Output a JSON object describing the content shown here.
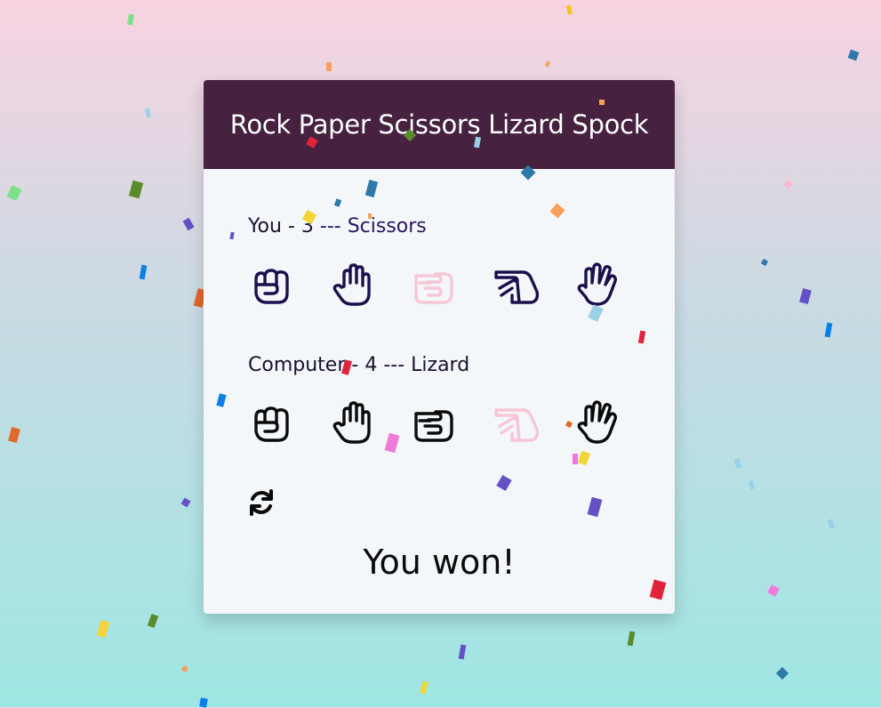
{
  "header": {
    "title": "Rock Paper Scissors Lizard Spock"
  },
  "player": {
    "label": "You",
    "score": "3",
    "choice": "Scissors",
    "options": [
      {
        "name": "rock",
        "icon": "fist-icon"
      },
      {
        "name": "paper",
        "icon": "open-hand-icon"
      },
      {
        "name": "scissors",
        "icon": "scissors-hand-icon",
        "chosen": true
      },
      {
        "name": "lizard",
        "icon": "lizard-hand-icon"
      },
      {
        "name": "spock",
        "icon": "spock-hand-icon"
      }
    ]
  },
  "computer": {
    "label": "Computer",
    "score": "4",
    "choice": "Lizard",
    "options": [
      {
        "name": "rock",
        "icon": "fist-icon"
      },
      {
        "name": "paper",
        "icon": "open-hand-icon"
      },
      {
        "name": "scissors",
        "icon": "scissors-hand-icon"
      },
      {
        "name": "lizard",
        "icon": "lizard-hand-icon",
        "chosen": true
      },
      {
        "name": "spock",
        "icon": "spock-hand-icon"
      }
    ]
  },
  "separator": "---",
  "dash": "-",
  "reset": {
    "icon": "refresh-icon"
  },
  "result": "You won!",
  "colors": {
    "header_bg": "#462240",
    "card_bg": "#f4f7fa",
    "chosen_icon": "#f7c6d8",
    "player_icon": "#1d0f4d",
    "computer_icon": "#0a0a0a"
  }
}
